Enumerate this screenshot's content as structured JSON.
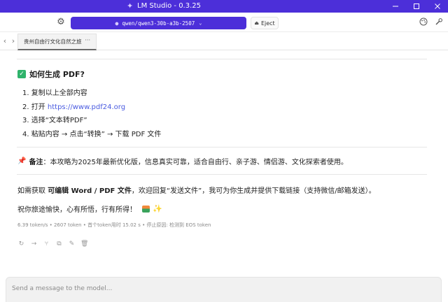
{
  "window": {
    "title": "LM Studio - 0.3.25",
    "controls": [
      "minimize",
      "maximize",
      "close"
    ]
  },
  "toolbar": {
    "model_name": "qwen/qwen3-30b-a3b-2507",
    "eject_label": "Eject",
    "icons": [
      "gear-icon",
      "palette-icon",
      "wrench-icon"
    ]
  },
  "tabs": [
    {
      "label": "贵州自由行文化自然之旅",
      "more": "···"
    }
  ],
  "message": {
    "heading": "如何生成 PDF?",
    "steps": [
      {
        "text": "1. 复制以上全部内容"
      },
      {
        "prefix": "2. 打开 ",
        "link": "https://www.pdf24.org"
      },
      {
        "text": "3. 选择“文本转PDF”"
      },
      {
        "text": "4. 粘贴内容 → 点击“转换” → 下载 PDF 文件"
      }
    ],
    "note_label": "备注",
    "note_text": "：本攻略为2025年最新优化版，信息真实可靠，适合自由行、亲子游、情侣游、文化探索者使用。",
    "p1_prefix": "如需获取 ",
    "p1_bold": "可编辑 Word / PDF 文件",
    "p1_suffix": "，欢迎回复“发送文件”，我可为你生成并提供下载链接（支持微信/邮箱发送）。",
    "p2_text": "祝你旅途愉快，心有所悟，行有所得！",
    "stats": "6.39 token/s • 2607 token • 首个token用时 15.02 s • 停止原因: 检测到 EOS token"
  },
  "actions": [
    "regenerate-icon",
    "continue-icon",
    "branch-icon",
    "copy-icon",
    "edit-icon",
    "delete-icon"
  ],
  "input": {
    "placeholder": "Send a message to the model..."
  },
  "colors": {
    "accent": "#4c2fd9",
    "link": "#4a5be0",
    "check": "#2fb36b"
  }
}
